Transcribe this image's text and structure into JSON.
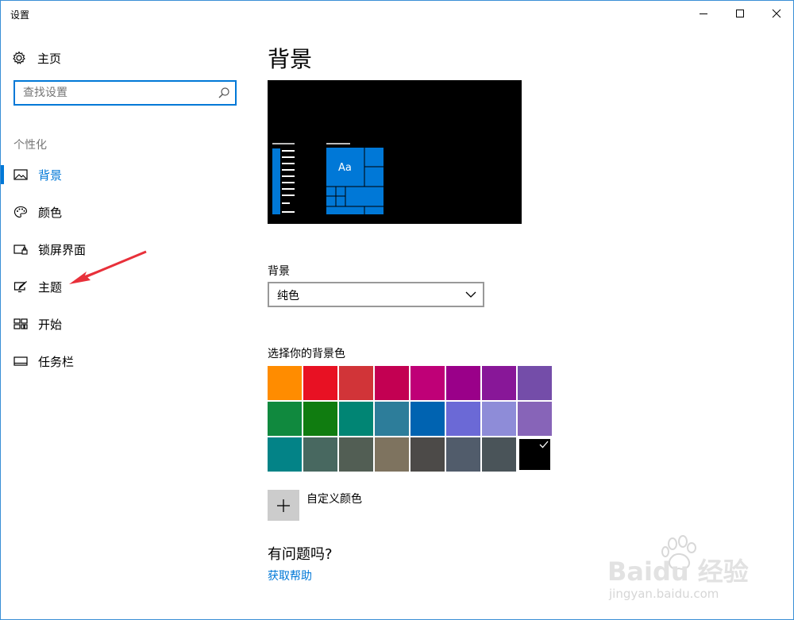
{
  "window": {
    "title": "设置"
  },
  "sidebar": {
    "home_label": "主页",
    "search_placeholder": "查找设置",
    "search_value": "",
    "section_label": "个性化",
    "items": [
      {
        "label": "背景",
        "icon": "picture-icon",
        "active": true
      },
      {
        "label": "颜色",
        "icon": "palette-icon",
        "active": false
      },
      {
        "label": "锁屏界面",
        "icon": "lock-screen-icon",
        "active": false
      },
      {
        "label": "主题",
        "icon": "theme-brush-icon",
        "active": false
      },
      {
        "label": "开始",
        "icon": "start-menu-icon",
        "active": false
      },
      {
        "label": "任务栏",
        "icon": "taskbar-icon",
        "active": false
      }
    ]
  },
  "main": {
    "title": "背景",
    "preview_tile_text": "Aa",
    "background_label": "背景",
    "background_value": "纯色",
    "color_label": "选择你的背景色",
    "custom_color_label": "自定义颜色",
    "help_title": "有问题吗?",
    "help_link": "获取帮助"
  },
  "colors": {
    "accent": "#0078d7",
    "swatches": [
      [
        "#ff8c00",
        "#e81123",
        "#d13438",
        "#c30052",
        "#bf0077",
        "#9a0089",
        "#881798",
        "#744da9"
      ],
      [
        "#10893e",
        "#107c10",
        "#018574",
        "#2d7d9a",
        "#0063b1",
        "#6b69d6",
        "#8e8cd8",
        "#8764b8"
      ],
      [
        "#038387",
        "#486860",
        "#525e54",
        "#7e735f",
        "#4c4a48",
        "#515c6b",
        "#4a5459",
        "#000000"
      ]
    ],
    "selected_swatch": "#000000"
  },
  "watermark": {
    "brand": "Baidu 经验",
    "url": "jingyan.baidu.com"
  }
}
